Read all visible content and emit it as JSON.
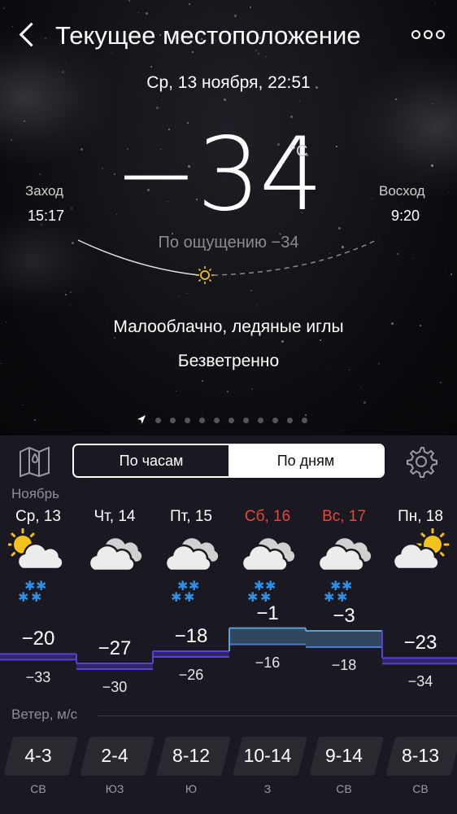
{
  "header": {
    "title": "Текущее местоположение"
  },
  "now": {
    "datetime": "Ср, 13 ноября, 22:51",
    "temperature": "−34",
    "unit": "°C",
    "feels_like": "По ощущению −34",
    "condition": "Малооблачно, ледяные иглы",
    "wind": "Безветренно"
  },
  "sun": {
    "sunset_label": "Заход",
    "sunset_time": "15:17",
    "sunrise_label": "Восход",
    "sunrise_time": "9:20"
  },
  "pager": {
    "pages": 12,
    "current": 0
  },
  "tabs": {
    "hourly": "По часам",
    "daily": "По дням",
    "active": "daily"
  },
  "month": "Ноябрь",
  "days": [
    {
      "name": "Ср, 13",
      "weekend": false,
      "icon": "partly-cloudy-snow-icon",
      "high": "−20",
      "low": "−33",
      "high_value": -20,
      "low_value": -33,
      "wind_speed": "4-3",
      "wind_dir": "СВ"
    },
    {
      "name": "Чт, 14",
      "weekend": false,
      "icon": "cloudy-icon",
      "high": "−27",
      "low": "−30",
      "high_value": -27,
      "low_value": -30,
      "wind_speed": "2-4",
      "wind_dir": "ЮЗ"
    },
    {
      "name": "Пт, 15",
      "weekend": false,
      "icon": "cloudy-snow-icon",
      "high": "−18",
      "low": "−26",
      "high_value": -18,
      "low_value": -26,
      "wind_speed": "8-12",
      "wind_dir": "Ю"
    },
    {
      "name": "Сб, 16",
      "weekend": true,
      "icon": "cloudy-snow-icon",
      "high": "−1",
      "low": "−16",
      "high_value": -1,
      "low_value": -16,
      "wind_speed": "10-14",
      "wind_dir": "З"
    },
    {
      "name": "Вс, 17",
      "weekend": true,
      "icon": "cloudy-snow-icon",
      "high": "−3",
      "low": "−18",
      "high_value": -3,
      "low_value": -18,
      "wind_speed": "9-14",
      "wind_dir": "СВ"
    },
    {
      "name": "Пн, 18",
      "weekend": false,
      "icon": "partly-cloudy-icon",
      "high": "−23",
      "low": "−34",
      "high_value": -23,
      "low_value": -34,
      "wind_speed": "8-13",
      "wind_dir": "СВ"
    }
  ],
  "wind_section_label": "Ветер, м/с",
  "colors": {
    "weekend": "#e8453c",
    "cold_line": "#5a3ee0",
    "warm_line": "#5aa0d0",
    "sun": "#f5c21b"
  }
}
